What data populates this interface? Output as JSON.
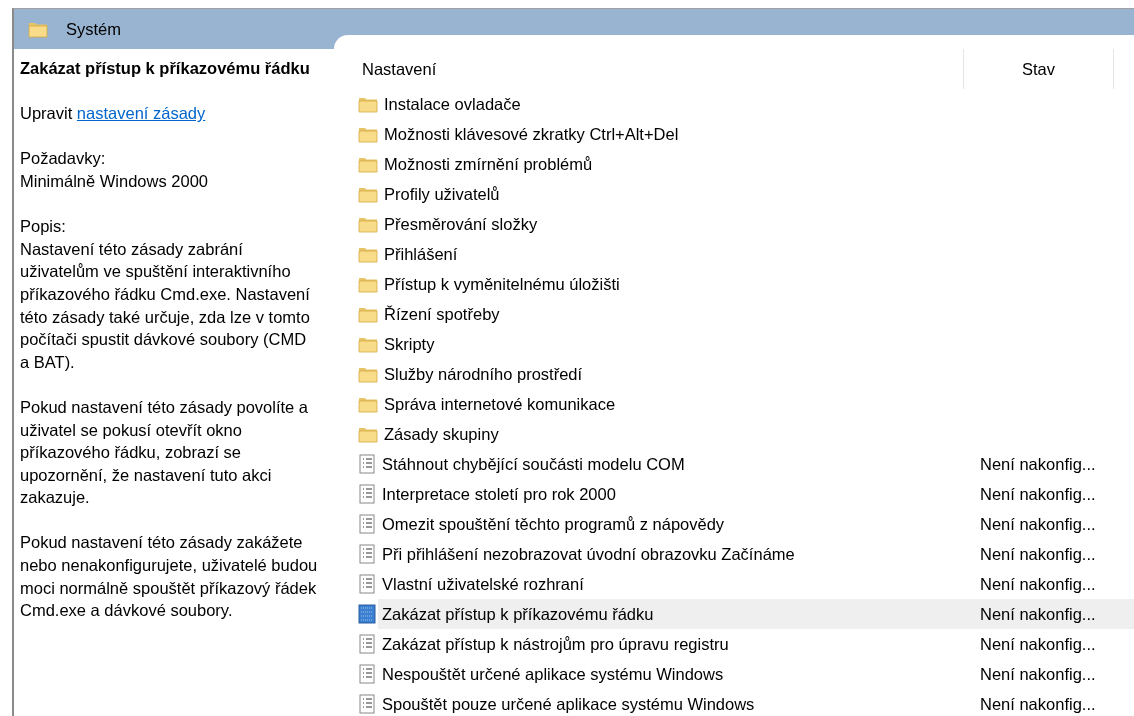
{
  "header": {
    "title": "Systém"
  },
  "details": {
    "title": "Zakázat přístup k příkazovému řádku",
    "edit_prefix": "Upravit",
    "edit_link": "nastavení zásady",
    "requirements_label": "Požadavky:",
    "requirements": "Minimálně Windows 2000",
    "description_label": "Popis:",
    "paragraphs": [
      "Nastavení této zásady zabrání uživatelům ve spuštění interaktivního příkazového řádku Cmd.exe. Nastavení této zásady také určuje, zda lze v tomto počítači spustit dávkové soubory (CMD a BAT).",
      "Pokud nastavení této zásady povolíte a uživatel se pokusí otevřít okno příkazového řádku, zobrazí se upozornění, že nastavení tuto akci zakazuje.",
      "Pokud nastavení této zásady zakážete nebo nenakonfigurujete, uživatelé budou moci normálně spouštět příkazový řádek Cmd.exe a dávkové soubory."
    ]
  },
  "table": {
    "columns": [
      "Nastavení",
      "Stav"
    ],
    "rows": [
      {
        "kind": "folder",
        "name": "Instalace ovladače",
        "selected": false
      },
      {
        "kind": "folder",
        "name": "Možnosti klávesové zkratky Ctrl+Alt+Del",
        "selected": false
      },
      {
        "kind": "folder",
        "name": "Možnosti zmírnění problémů",
        "selected": false
      },
      {
        "kind": "folder",
        "name": "Profily uživatelů",
        "selected": false
      },
      {
        "kind": "folder",
        "name": "Přesměrování složky",
        "selected": false
      },
      {
        "kind": "folder",
        "name": "Přihlášení",
        "selected": false
      },
      {
        "kind": "folder",
        "name": "Přístup k vyměnitelnému úložišti",
        "selected": false
      },
      {
        "kind": "folder",
        "name": "Řízení spotřeby",
        "selected": false
      },
      {
        "kind": "folder",
        "name": "Skripty",
        "selected": false
      },
      {
        "kind": "folder",
        "name": "Služby národního prostředí",
        "selected": false
      },
      {
        "kind": "folder",
        "name": "Správa internetové komunikace",
        "selected": false
      },
      {
        "kind": "folder",
        "name": "Zásady skupiny",
        "selected": false
      },
      {
        "kind": "policy",
        "name": "Stáhnout chybějící součásti modelu COM",
        "status": "Není nakonfig...",
        "selected": false
      },
      {
        "kind": "policy",
        "name": "Interpretace století pro rok 2000",
        "status": "Není nakonfig...",
        "selected": false
      },
      {
        "kind": "policy",
        "name": "Omezit spouštění těchto programů z nápovědy",
        "status": "Není nakonfig...",
        "selected": false
      },
      {
        "kind": "policy",
        "name": "Při přihlášení nezobrazovat úvodní obrazovku Začínáme",
        "status": "Není nakonfig...",
        "selected": false
      },
      {
        "kind": "policy",
        "name": "Vlastní uživatelské rozhraní",
        "status": "Není nakonfig...",
        "selected": false
      },
      {
        "kind": "policy",
        "name": "Zakázat přístup k příkazovému řádku",
        "status": "Není nakonfig...",
        "selected": true
      },
      {
        "kind": "policy",
        "name": "Zakázat přístup k nástrojům pro úpravu registru",
        "status": "Není nakonfig...",
        "selected": false
      },
      {
        "kind": "policy",
        "name": "Nespouštět určené aplikace systému Windows",
        "status": "Není nakonfig...",
        "selected": false
      },
      {
        "kind": "policy",
        "name": "Spouštět pouze určené aplikace systému Windows",
        "status": "Není nakonfig...",
        "selected": false
      }
    ]
  }
}
